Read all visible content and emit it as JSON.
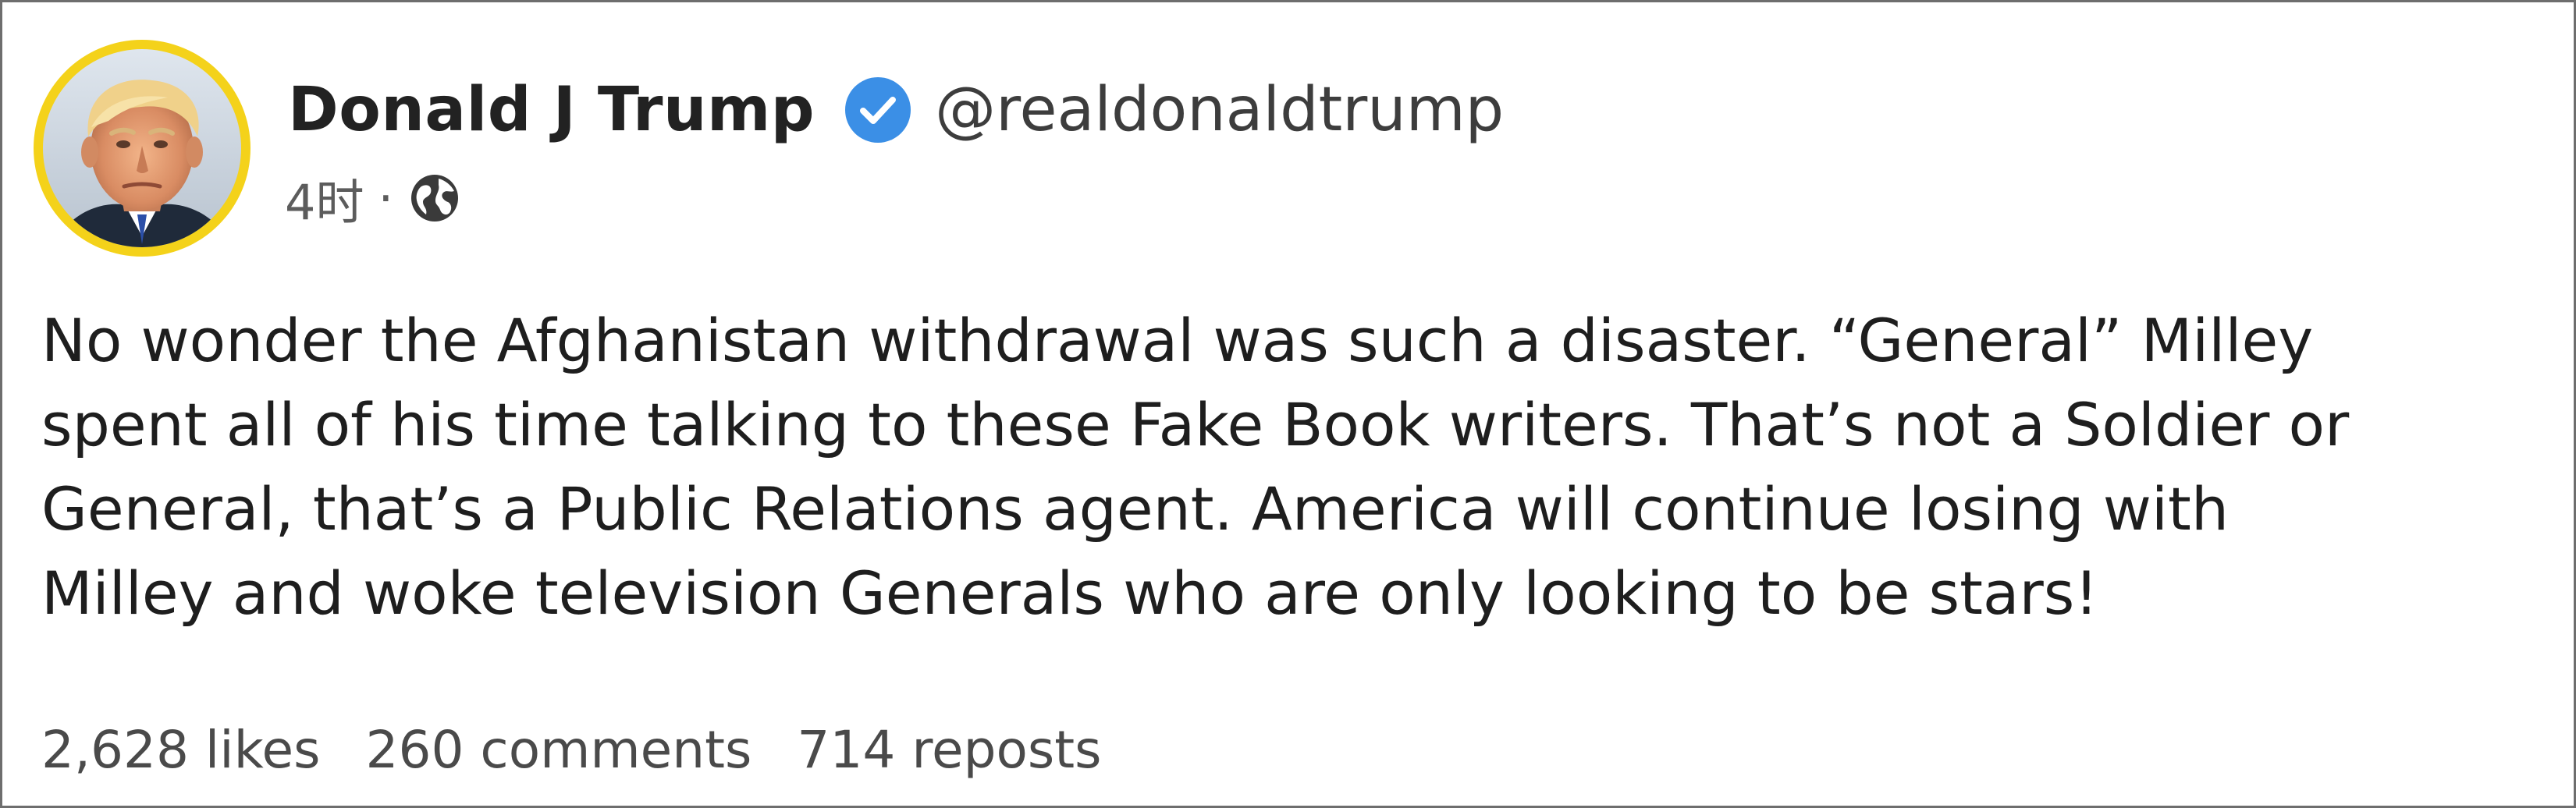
{
  "post": {
    "author": {
      "display_name": "Donald J Trump",
      "handle": "@realdonaldtrump",
      "verified": true,
      "avatar_ring_color": "#f4d21a"
    },
    "meta": {
      "time_ago": "4时",
      "separator": "·",
      "visibility_icon": "globe-icon"
    },
    "text_lines": [
      "No wonder the Afghanistan withdrawal was such a disaster. “General” Milley",
      "spent all of his time talking to these Fake Book writers. That’s not a Soldier or",
      "General, that’s a Public Relations agent. America will continue losing with",
      "Milley and woke television Generals who are only looking to be stars!"
    ],
    "stats": {
      "likes": "2,628 likes",
      "comments": "260 comments",
      "reposts": "714 reposts"
    },
    "colors": {
      "verified_badge": "#3b8fe6",
      "border": "#6e6e6e"
    }
  }
}
